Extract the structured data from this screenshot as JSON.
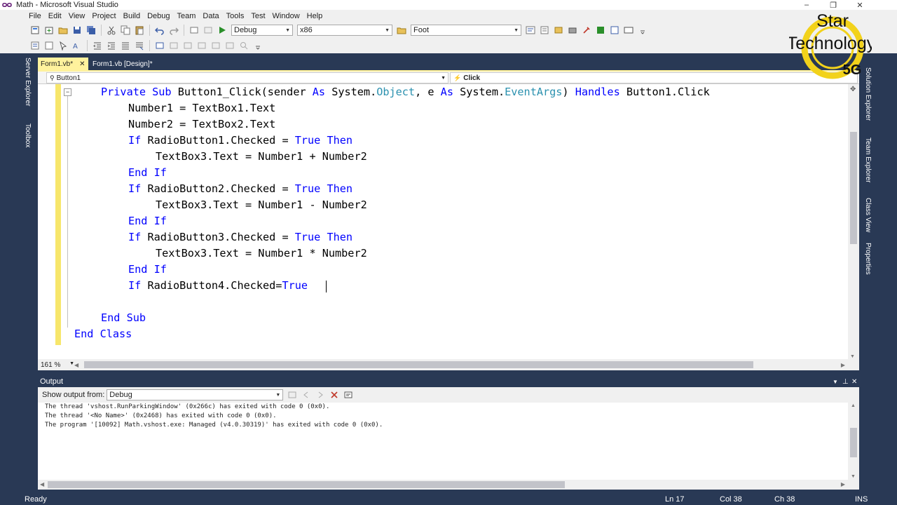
{
  "window": {
    "title": "Math - Microsoft Visual Studio",
    "minimize_glyph": "–",
    "restore_glyph": "❐",
    "close_glyph": "✕"
  },
  "menu": [
    "File",
    "Edit",
    "View",
    "Project",
    "Build",
    "Debug",
    "Team",
    "Data",
    "Tools",
    "Test",
    "Window",
    "Help"
  ],
  "toolbar": {
    "config": "Debug",
    "platform": "x86",
    "find_text": "Foot"
  },
  "side_left": {
    "server_explorer": "Server Explorer",
    "toolbox": "Toolbox"
  },
  "side_right": {
    "solution_explorer": "Solution Explorer",
    "team_explorer": "Team Explorer",
    "class_view": "Class View",
    "properties": "Properties"
  },
  "tabs": [
    {
      "label": "Form1.vb*",
      "close": "✕",
      "active": true
    },
    {
      "label": "Form1.vb [Design]*",
      "active": false
    }
  ],
  "navbar": {
    "object": "Button1",
    "event": "Click"
  },
  "code": {
    "line1": {
      "kw1": "Private Sub ",
      "t1": "Button1_Click(sender ",
      "kw2": "As ",
      "t2": "System.",
      "ty1": "Object",
      "t3": ", e ",
      "kw3": "As ",
      "t4": "System.",
      "ty2": "EventArgs",
      "t5": ") ",
      "kw4": "Handles ",
      "t6": "Button1.Click"
    },
    "line2": "Number1 = TextBox1.Text",
    "line3": "Number2 = TextBox2.Text",
    "line4": {
      "kw1": "If ",
      "t1": "RadioButton1.Checked = ",
      "kw2": "True Then"
    },
    "line5": "TextBox3.Text = Number1 + Number2",
    "line6": "End If",
    "line7": {
      "kw1": "If ",
      "t1": "RadioButton2.Checked = ",
      "kw2": "True Then"
    },
    "line8": "TextBox3.Text = Number1 - Number2",
    "line9": "End If",
    "line10": {
      "kw1": "If ",
      "t1": "RadioButton3.Checked = ",
      "kw2": "True Then"
    },
    "line11": "TextBox3.Text = Number1 * Number2",
    "line12": "End If",
    "line13": {
      "kw1": "If ",
      "t1": "RadioButton4.Checked=",
      "kw2": "True"
    },
    "line15": "End Sub",
    "line16": "End Class"
  },
  "editor": {
    "zoom": "161 %"
  },
  "output": {
    "title": "Output",
    "show_from_label": "Show output from:",
    "show_from_value": "Debug",
    "lines": [
      "The thread 'vshost.RunParkingWindow' (0x266c) has exited with code 0 (0x0).",
      "The thread '<No Name>' (0x2468) has exited with code 0 (0x0).",
      "The program '[10092] Math.vshost.exe: Managed (v4.0.30319)' has exited with code 0 (0x0)."
    ]
  },
  "status": {
    "left": "Ready",
    "ln": "Ln 17",
    "col": "Col 38",
    "ch": "Ch 38",
    "mode": "INS"
  },
  "watermark": {
    "line1": "Star",
    "line2": "Technology",
    "line3": "5G"
  },
  "colors": {
    "chrome_dark": "#293955",
    "tab_active": "#fff29d",
    "keyword": "#0000ff",
    "type": "#2b91af",
    "margin_marker": "#f7e66b"
  }
}
